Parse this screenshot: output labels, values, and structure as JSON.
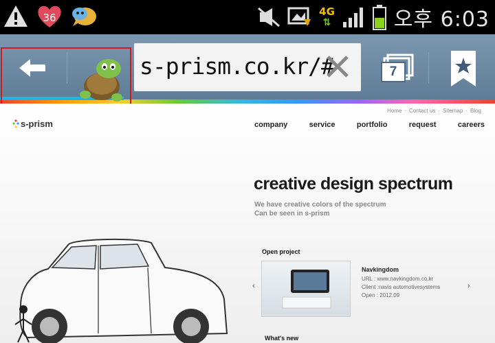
{
  "status_bar": {
    "notification_badge": "36",
    "network": "4G",
    "clock": "오후 6:03"
  },
  "browser": {
    "url": "s-prism.co.kr/#",
    "tab_count": "7",
    "annotation": "?..."
  },
  "site": {
    "utility_links": [
      "Home",
      "·",
      "Contact us",
      "·",
      "Sitemap",
      "·",
      "Blog"
    ],
    "logo": "s-prism",
    "nav": [
      "company",
      "service",
      "portfolio",
      "request",
      "careers"
    ],
    "hero_title": "creative design spectrum",
    "hero_sub_1": "We have creative colors of the spectrum",
    "hero_sub_2": "Can be seen in s-prism",
    "open_project_title": "Open project",
    "project": {
      "name": "Navkingdom",
      "url": "URL : www.navkingdom.co.kr",
      "client": "Client :navis automotivesystems",
      "open": "Open : 2012.09"
    },
    "whats_new": "What's new"
  },
  "colors": {
    "statusbar_bg": "#000000",
    "browser_bar": "#6f8aa3",
    "highlight_box": "#d31919",
    "progress": "#1fb3e8"
  }
}
